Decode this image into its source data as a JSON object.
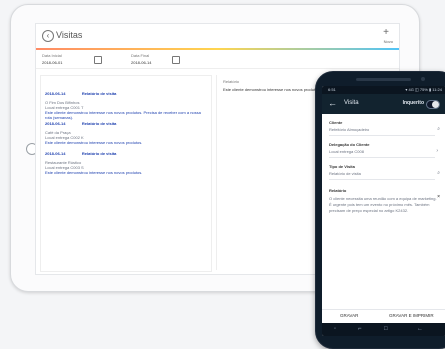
{
  "tablet": {
    "title": "Visitas",
    "new_label": "Novo",
    "filters": {
      "start_label": "Data Inicial",
      "start_value": "2018-06-01",
      "end_label": "Data Final",
      "end_value": "2018-06-14"
    },
    "visits": [
      {
        "date": "2018-06-14",
        "title": "Relatório de visita",
        "client": "O Fim Dos Bifinhos",
        "location": "Local entrega C001 T",
        "desc": "Este cliente demonstrou interesse nos novos produtos. Precisa de receber com a nossa rota (semanas)."
      },
      {
        "date": "2018-06-14",
        "title": "Relatório de visita",
        "client": "Café da Praça",
        "location": "Local entrega C002 K",
        "desc": "Este cliente demonstrou interesse nos novos produtos."
      },
      {
        "date": "2018-06-14",
        "title": "Relatório de visita",
        "client": "Restaurante Rústico",
        "location": "Local entrega C003 S",
        "desc": "Este cliente demonstrou interesse nos novos produtos."
      }
    ],
    "detail": {
      "label": "Relatório",
      "text": "Este cliente demonstrou interesse nos novos produtos. Precisa..."
    }
  },
  "phone": {
    "status": {
      "time": "6:51",
      "right": "▾ 4G ◫ 75% ▮ 11:24"
    },
    "title": "Visita",
    "toggle_label": "Inquerito",
    "fields": [
      {
        "label": "Cliente",
        "value": "Refeitório Almoçadeiro"
      },
      {
        "label": "Delegação do Cliente",
        "value": "Local entrega C008"
      },
      {
        "label": "Tipo de Visita",
        "value": "Relatório de visita"
      }
    ],
    "report_label": "Relatório",
    "report_text": "O cliente necessita uma reunião com a equipa de marketing. É urgente pois tem um evento no próximo mês. Também precisam de preço especial no artigo K2432.",
    "buttons": {
      "save": "GRAVAR",
      "save_print": "GRAVAR E IMPRIMIR"
    },
    "nav": [
      "◦",
      "⌐",
      "□",
      "←"
    ]
  }
}
